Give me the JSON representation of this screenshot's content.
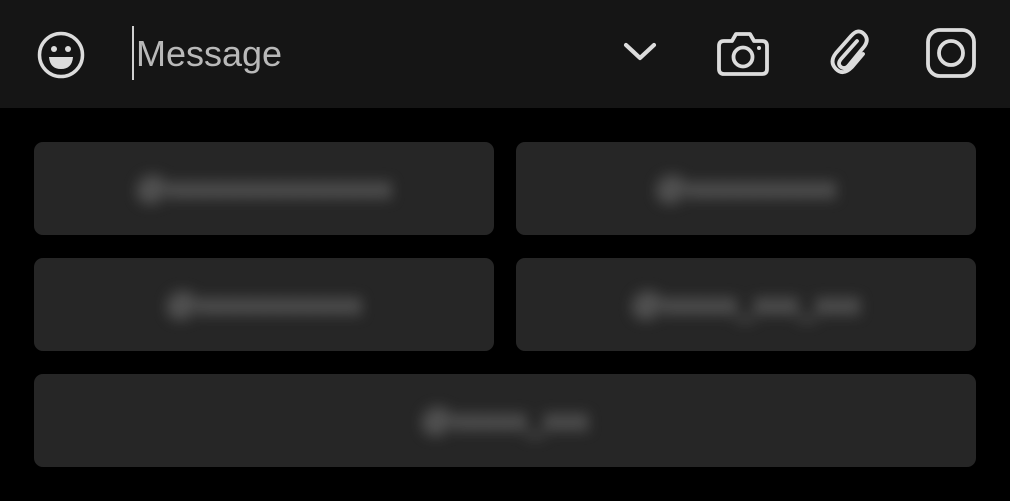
{
  "input_bar": {
    "message_placeholder": "Message",
    "icons": {
      "emoji": "emoji-icon",
      "expand": "chevron-down-icon",
      "camera": "camera-icon",
      "attach": "paperclip-icon",
      "sticker": "instagram-icon"
    }
  },
  "keyboard": {
    "buttons": [
      {
        "label": "@xxxxxxxxxxxxxxx"
      },
      {
        "label": "@xxxxxxxxxx"
      },
      {
        "label": "@xxxxxxxxxxx"
      },
      {
        "label": "@xxxxx_xxx_xxx"
      },
      {
        "label": "@xxxxx_xxx"
      }
    ]
  },
  "colors": {
    "background": "#000000",
    "input_bar": "#151515",
    "button": "#262626",
    "icon": "#dcdcdc",
    "placeholder": "#b9b9b9"
  }
}
